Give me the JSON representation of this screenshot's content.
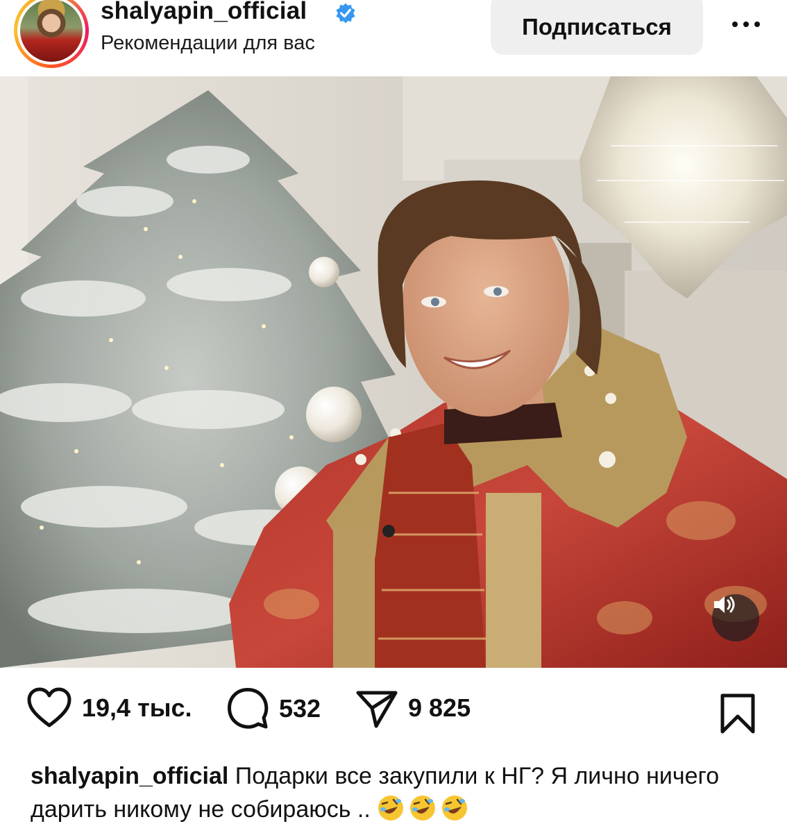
{
  "header": {
    "username": "shalyapin_official",
    "subtitle": "Рекомендации для вас",
    "subscribe_label": "Подписаться",
    "verified_icon": "verified-badge-icon",
    "more_icon": "more-dots-icon"
  },
  "post": {
    "sound_icon": "sound-on-icon"
  },
  "actions": {
    "likes": "19,4 тыс.",
    "comments": "532",
    "shares": "9 825",
    "like_icon": "heart-icon",
    "comment_icon": "comment-bubble-icon",
    "share_icon": "send-icon",
    "save_icon": "bookmark-icon"
  },
  "caption": {
    "username": "shalyapin_official",
    "text": "Подарки все закупили к НГ? Я лично ничего дарить никому не собираюсь ..",
    "emoji_icon": "rolling-on-floor-laughing-emoji"
  },
  "colors": {
    "verified_blue": "#3797f0",
    "button_bg": "#efefef",
    "text": "#111111"
  }
}
